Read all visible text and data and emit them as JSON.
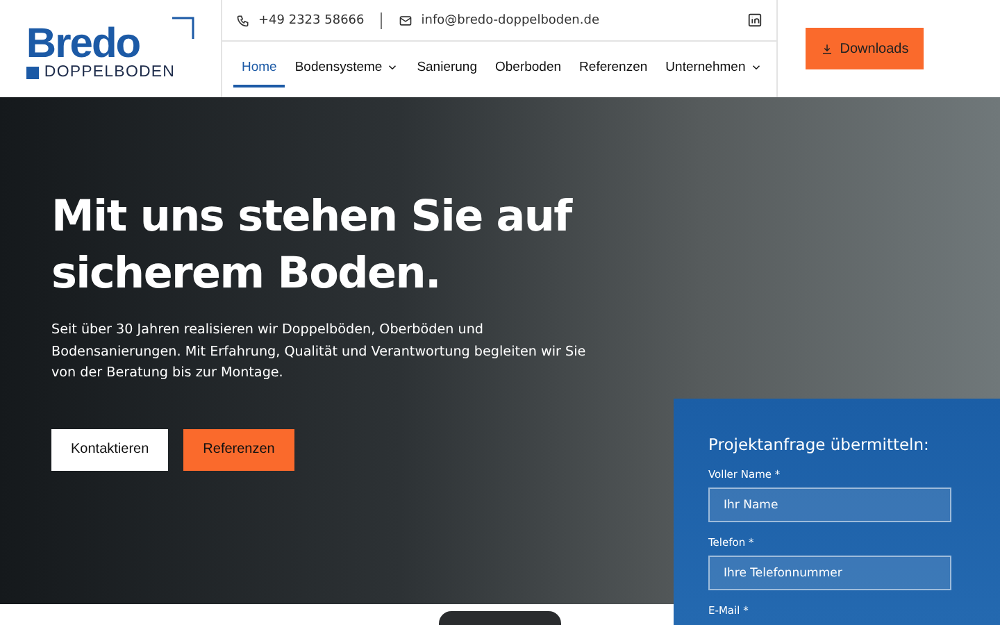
{
  "header": {
    "logo": {
      "brand": "Bredo",
      "sub": "DOPPELBODEN"
    },
    "phone": "+49 2323 58666",
    "email": "info@bredo-doppelboden.de",
    "nav": [
      {
        "label": "Home",
        "selected": true,
        "dropdown": false
      },
      {
        "label": "Bodensysteme",
        "selected": false,
        "dropdown": true
      },
      {
        "label": "Sanierung",
        "selected": false,
        "dropdown": false
      },
      {
        "label": "Oberboden",
        "selected": false,
        "dropdown": false
      },
      {
        "label": "Referenzen",
        "selected": false,
        "dropdown": false
      },
      {
        "label": "Unternehmen",
        "selected": false,
        "dropdown": true
      }
    ],
    "cta": "Downloads"
  },
  "hero": {
    "title": "Mit uns stehen Sie auf sicherem Boden.",
    "text": "Seit über 30 Jahren realisieren wir Doppelböden, Oberböden und Bodensanierungen. Mit Erfahrung, Qualität und Verantwortung begleiten wir Sie von der Beratung bis zur Montage.",
    "buttons": [
      {
        "label": "Kontaktieren",
        "kind": "light"
      },
      {
        "label": "Referenzen",
        "kind": "accent"
      }
    ]
  },
  "form": {
    "title": "Projektanfrage übermitteln:",
    "fields": [
      {
        "label": "Voller Name *",
        "placeholder": "Ihr Name"
      },
      {
        "label": "Telefon *",
        "placeholder": "Ihre Telefonnummer"
      },
      {
        "label": "E-Mail *"
      }
    ]
  }
}
